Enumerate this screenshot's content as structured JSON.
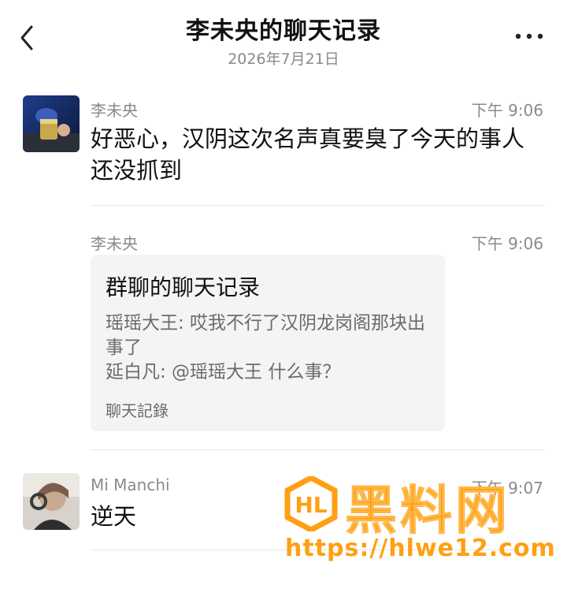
{
  "header": {
    "title": "李未央的聊天记录",
    "date": "2026年7月21日",
    "back_icon": "chevron-left-icon",
    "more_icon": "ellipsis-icon"
  },
  "messages": [
    {
      "sender": "李未央",
      "time": "下午 9:06",
      "text": "好恶心，汉阴这次名声真要臭了今天的事人还没抓到"
    },
    {
      "sender": "李未央",
      "time": "下午 9:06",
      "record": {
        "title": "群聊的聊天记录",
        "lines": [
          "瑶瑶大王: 哎我不行了汉阴龙岗阁那块出事了",
          "延白凡: @瑶瑶大王 什么事？"
        ],
        "footer": "聊天記錄"
      }
    },
    {
      "sender": "Mi Manchi",
      "time": "下午 9:07",
      "text": "逆天"
    }
  ],
  "watermark": {
    "brand": "黑料网",
    "url": "https://hlwe12.com",
    "color": "#ff9f12"
  }
}
